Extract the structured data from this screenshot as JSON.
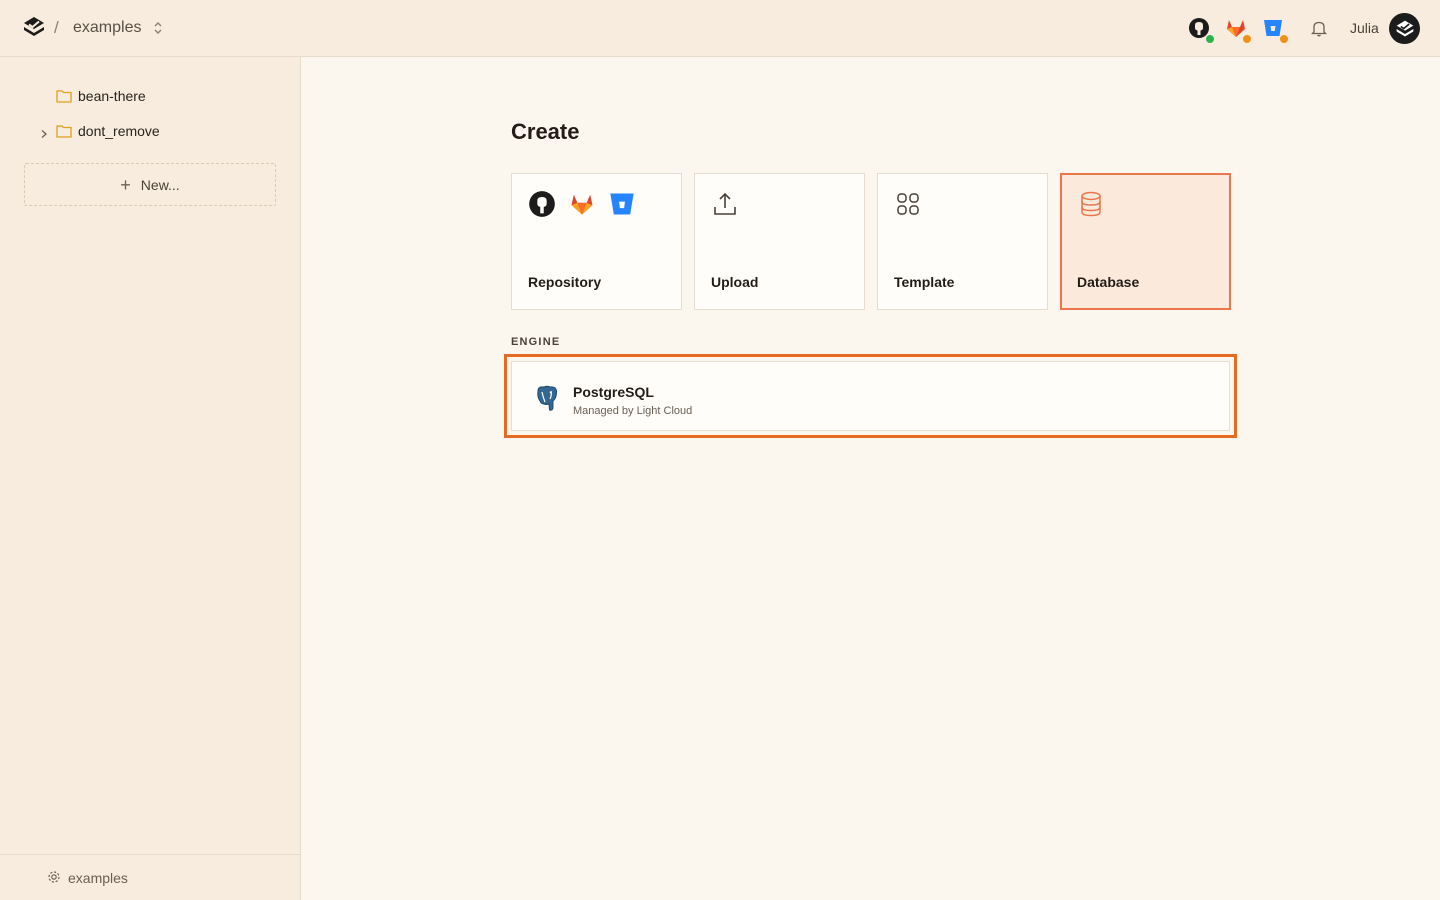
{
  "header": {
    "project": "examples",
    "separator": "/",
    "user": "Julia",
    "integrations": [
      {
        "name": "github-icon",
        "status_color": "#2fb24c"
      },
      {
        "name": "gitlab-icon",
        "status_color": "#f0901c"
      },
      {
        "name": "bitbucket-icon",
        "status_color": "#f0901c"
      }
    ]
  },
  "sidebar": {
    "items": [
      {
        "label": "bean-there",
        "expandable": false
      },
      {
        "label": "dont_remove",
        "expandable": true
      }
    ],
    "new_label": "New...",
    "footer_label": "examples"
  },
  "main": {
    "title": "Create",
    "cards": [
      {
        "label": "Repository",
        "selected": false
      },
      {
        "label": "Upload",
        "selected": false
      },
      {
        "label": "Template",
        "selected": false
      },
      {
        "label": "Database",
        "selected": true
      }
    ],
    "engine_section_label": "ENGINE",
    "engine": {
      "name": "PostgreSQL",
      "description": "Managed by Light Cloud"
    }
  },
  "colors": {
    "accent": "#e66a22",
    "selected_bg": "#fbe9dc",
    "folder": "#e0a020"
  }
}
